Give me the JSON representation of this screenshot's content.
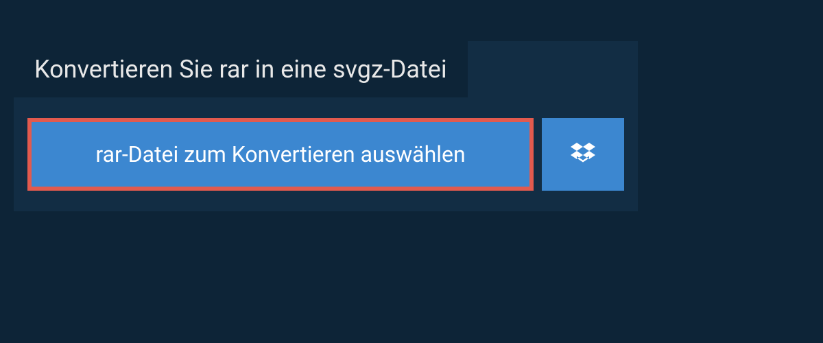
{
  "heading": "Konvertieren Sie rar in eine svgz-Datei",
  "select_file_label": "rar-Datei zum Konvertieren auswählen"
}
